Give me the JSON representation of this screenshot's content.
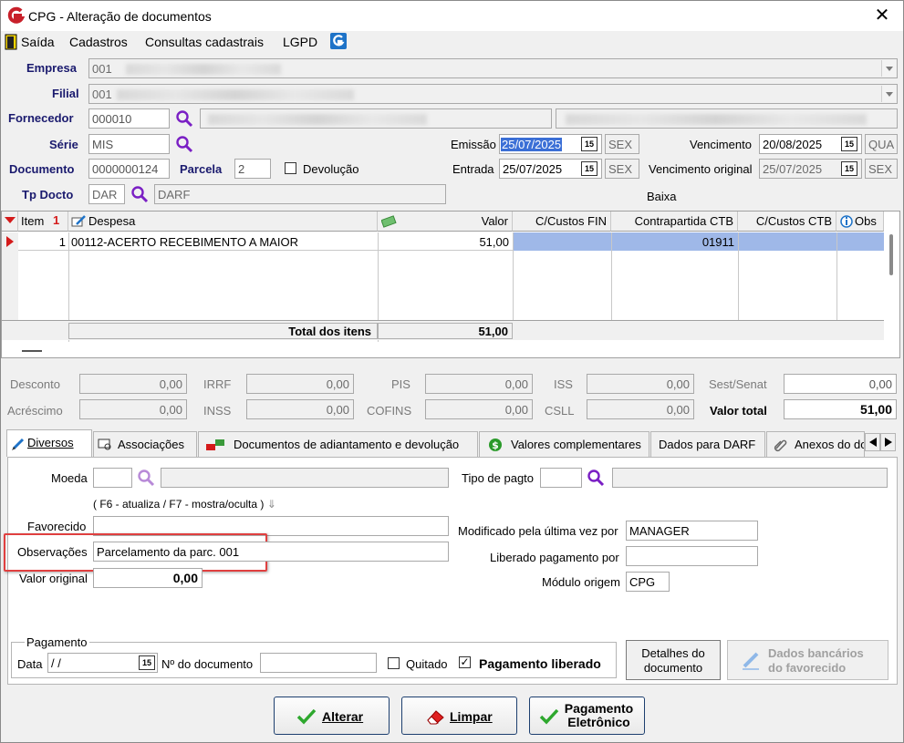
{
  "window": {
    "title": "CPG - Alteração de documentos"
  },
  "menu": {
    "items": [
      "Saída",
      "Cadastros",
      "Consultas cadastrais",
      "LGPD"
    ]
  },
  "header": {
    "empresa_label": "Empresa",
    "empresa_value": "001",
    "filial_label": "Filial",
    "filial_value": "001",
    "fornecedor_label": "Fornecedor",
    "fornecedor_value": "000010",
    "serie_label": "Série",
    "serie_value": "MIS",
    "documento_label": "Documento",
    "documento_value": "0000000124",
    "parcela_label": "Parcela",
    "parcela_value": "2",
    "devolucao_label": "Devolução",
    "tpdocto_label": "Tp Docto",
    "tpdocto_value": "DAR",
    "tpdocto_desc": "DARF",
    "emissao_label": "Emissão",
    "emissao_value": "25/07/2025",
    "emissao_day": "SEX",
    "entrada_label": "Entrada",
    "entrada_value": "25/07/2025",
    "entrada_day": "SEX",
    "vencimento_label": "Vencimento",
    "vencimento_value": "20/08/2025",
    "vencimento_day": "QUA",
    "venc_original_label": "Vencimento original",
    "venc_original_value": "25/07/2025",
    "venc_original_day": "SEX",
    "baixa_label": "Baixa",
    "calendar_glyph": "15"
  },
  "grid": {
    "columns": [
      "Item",
      "Despesa",
      "Valor",
      "C/Custos FIN",
      "Contrapartida CTB",
      "C/Custos CTB",
      "Obs"
    ],
    "rows": [
      {
        "item": "1",
        "despesa": "00112-ACERTO RECEBIMENTO A MAIOR",
        "valor": "51,00",
        "ccfin": "",
        "contrapartida": "01911",
        "ccctb": ""
      }
    ],
    "total_label": "Total dos itens",
    "total_value": "51,00"
  },
  "taxes": {
    "desconto_label": "Desconto",
    "desconto": "0,00",
    "acrescimo_label": "Acréscimo",
    "acrescimo": "0,00",
    "irrf_label": "IRRF",
    "irrf": "0,00",
    "inss_label": "INSS",
    "inss": "0,00",
    "pis_label": "PIS",
    "pis": "0,00",
    "cofins_label": "COFINS",
    "cofins": "0,00",
    "iss_label": "ISS",
    "iss": "0,00",
    "csll_label": "CSLL",
    "csll": "0,00",
    "sest_label": "Sest/Senat",
    "sest": "0,00",
    "valor_total_label": "Valor total",
    "valor_total": "51,00"
  },
  "tabs": [
    "Diversos",
    "Associações",
    "Documentos de adiantamento e devolução",
    "Valores complementares",
    "Dados para DARF",
    "Anexos do do"
  ],
  "diversos": {
    "moeda_label": "Moeda",
    "hint": "( F6 - atualiza / F7 - mostra/oculta )",
    "favorecido_label": "Favorecido",
    "observacoes_label": "Observações",
    "observacoes_value": "Parcelamento da parc. 001",
    "valor_original_label": "Valor original",
    "valor_original_value": "0,00",
    "tipo_pagto_label": "Tipo de pagto",
    "modificado_label": "Modificado pela última vez por",
    "modificado_value": "MANAGER",
    "liberado_label": "Liberado pagamento por",
    "modulo_label": "Módulo origem",
    "modulo_value": "CPG",
    "pagamento_group": "Pagamento",
    "data_label": "Data",
    "data_value": " /  /",
    "ndoc_label": "Nº do documento",
    "quitado_label": "Quitado",
    "pag_liberado_label": "Pagamento liberado",
    "detalhes_button": [
      "Detalhes do",
      "documento"
    ],
    "dados_bancarios_button": [
      "Dados bancários",
      "do favorecido"
    ]
  },
  "buttons": {
    "alterar": "Alterar",
    "limpar": "Limpar",
    "pagamento": [
      "Pagamento",
      "Eletrônico"
    ]
  },
  "colors": {
    "accent": "#1a1a6e",
    "selection": "#9fb8e8",
    "highlight_box": "#e04040"
  }
}
